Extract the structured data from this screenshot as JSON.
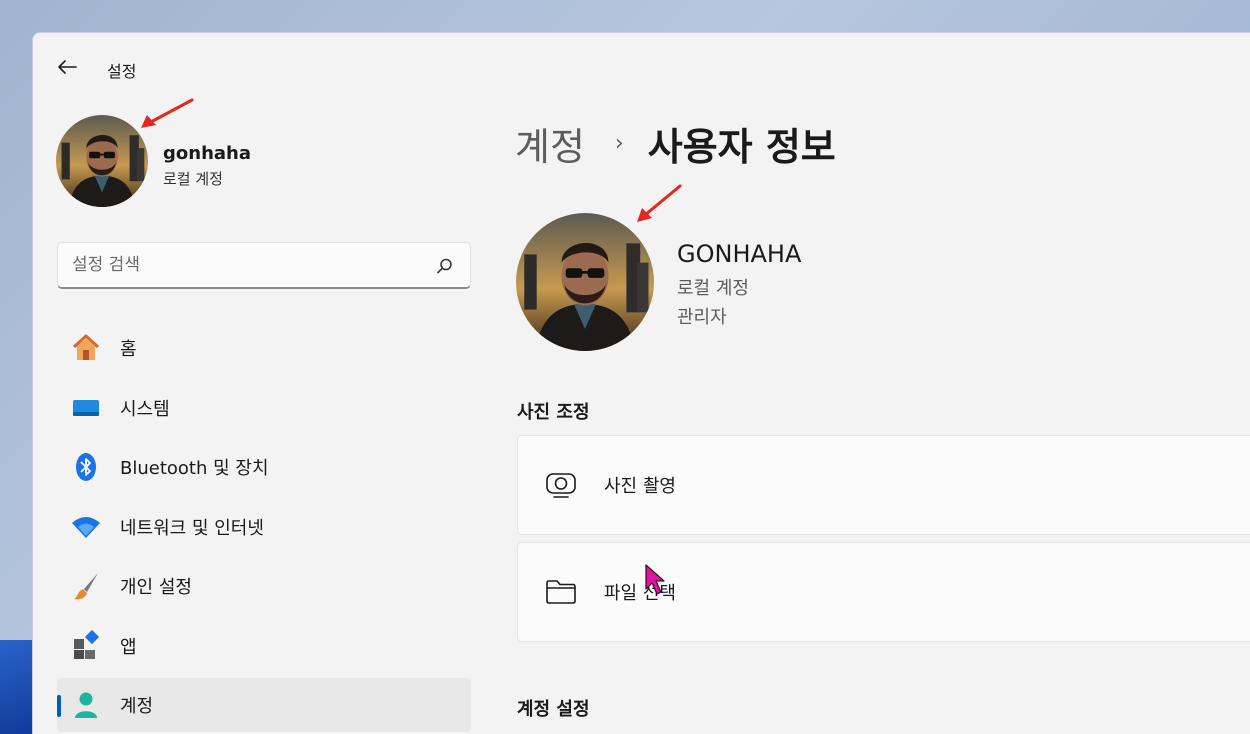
{
  "window": {
    "title": "설정"
  },
  "sidebar": {
    "user": {
      "name": "gonhaha",
      "account_type": "로컬 계정"
    },
    "search": {
      "placeholder": "설정 검색"
    },
    "items": [
      {
        "label": "홈",
        "icon": "home-icon"
      },
      {
        "label": "시스템",
        "icon": "system-icon"
      },
      {
        "label": "Bluetooth 및 장치",
        "icon": "bluetooth-icon"
      },
      {
        "label": "네트워크 및 인터넷",
        "icon": "wifi-icon"
      },
      {
        "label": "개인 설정",
        "icon": "brush-icon"
      },
      {
        "label": "앱",
        "icon": "apps-icon"
      },
      {
        "label": "계정",
        "icon": "account-icon",
        "active": true
      }
    ]
  },
  "main": {
    "breadcrumb": {
      "parent": "계정",
      "separator": "›",
      "current": "사용자 정보"
    },
    "profile": {
      "name": "GONHAHA",
      "account_type": "로컬 계정",
      "role": "관리자"
    },
    "photo_section": {
      "title": "사진 조정",
      "options": [
        {
          "label": "사진 촬영",
          "icon": "camera-icon"
        },
        {
          "label": "파일 선택",
          "icon": "folder-icon"
        }
      ]
    },
    "account_section": {
      "title": "계정 설정"
    }
  },
  "colors": {
    "accent": "#005fb8",
    "annotation_arrow": "#e8251f",
    "cursor": "#e0169a"
  }
}
